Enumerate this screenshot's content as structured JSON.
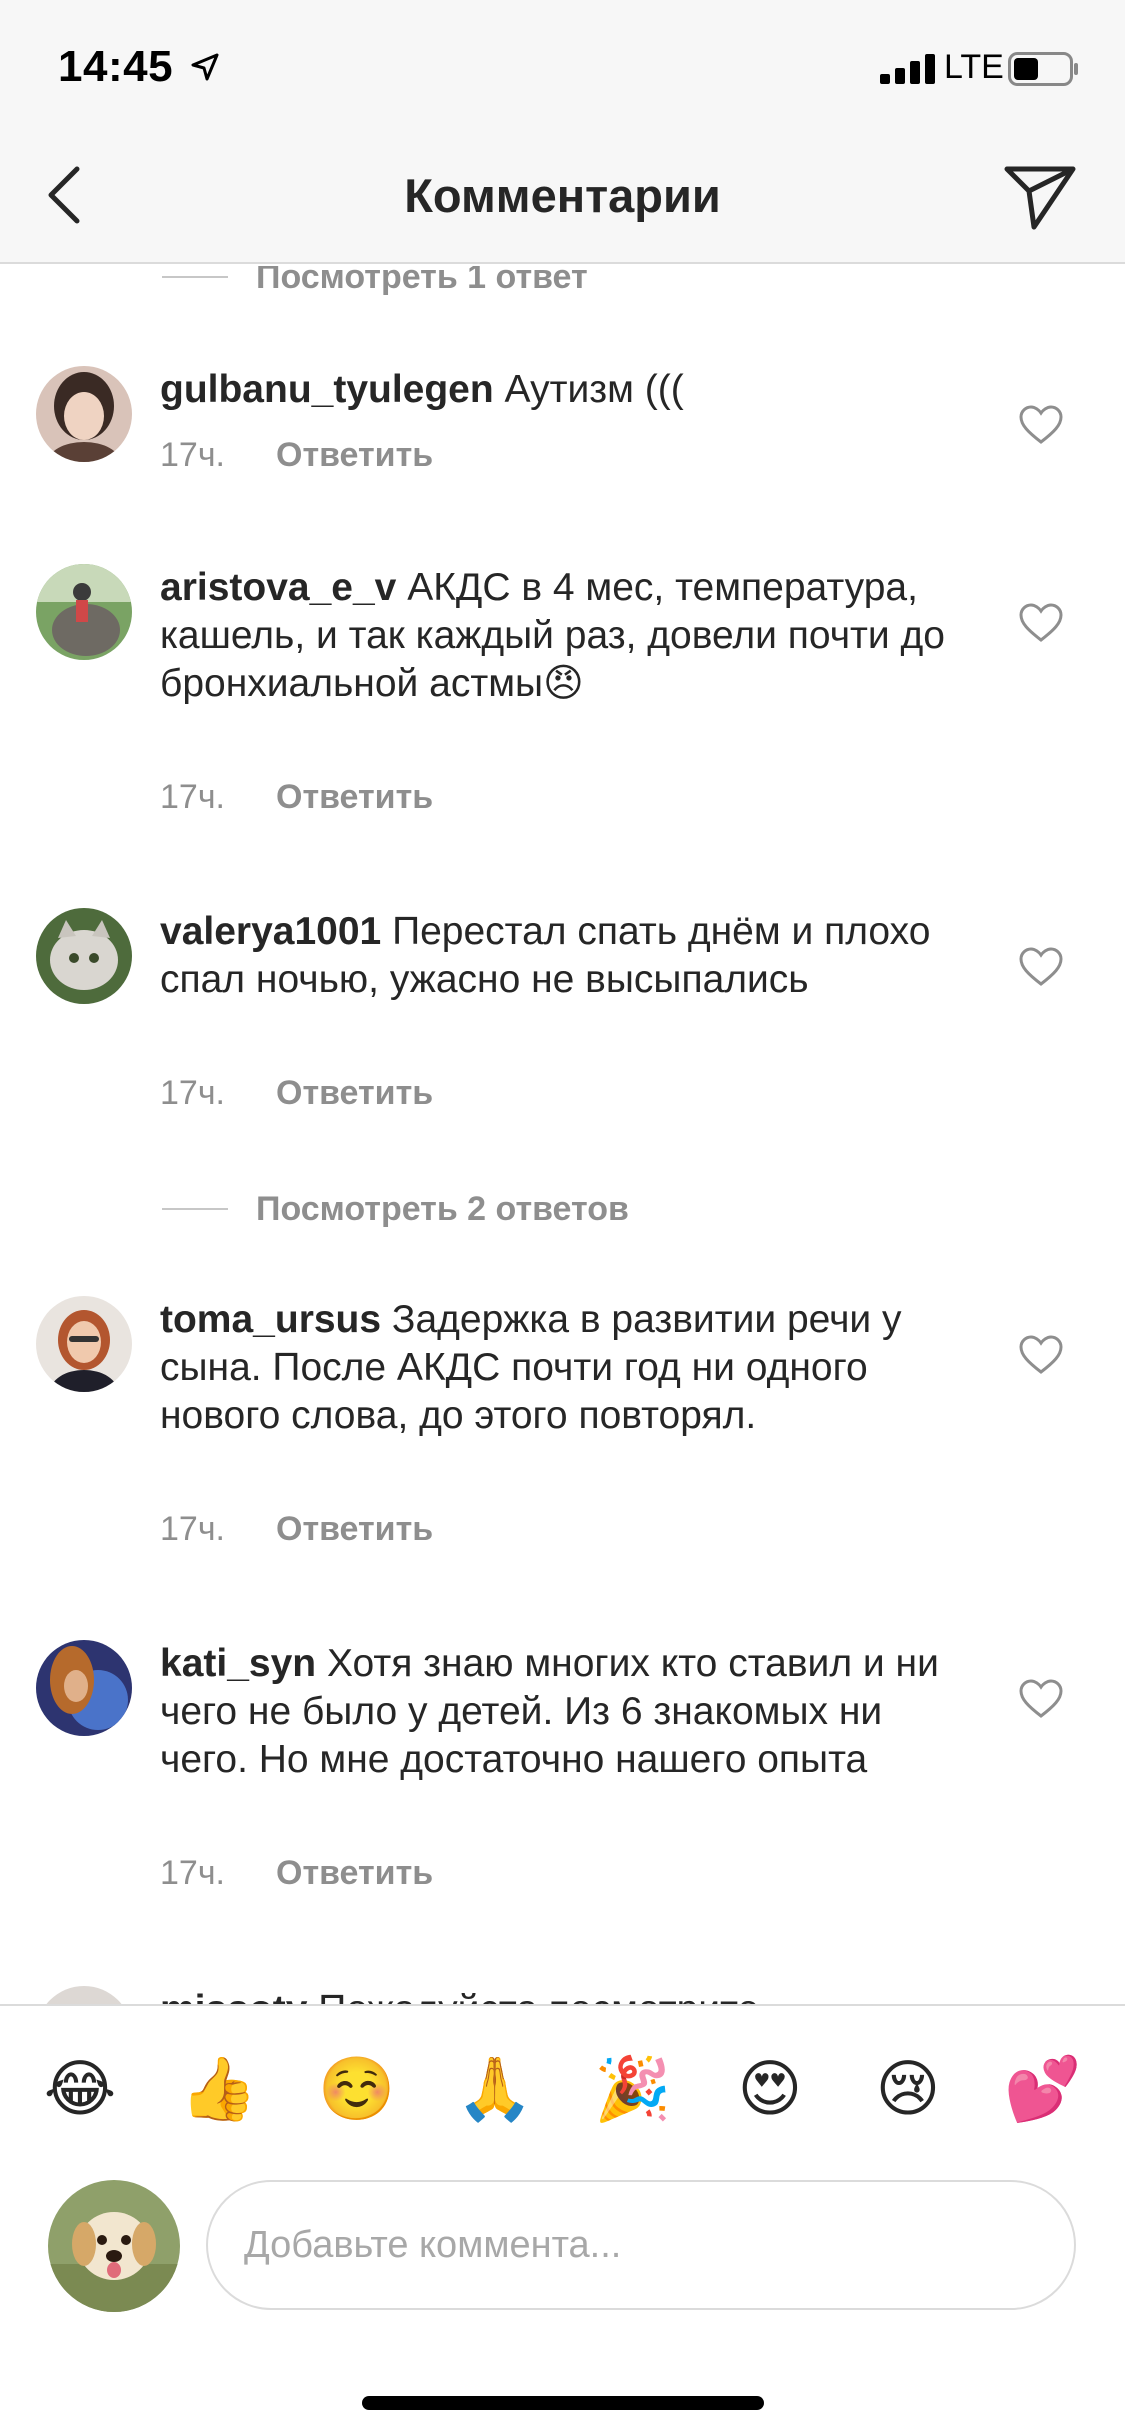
{
  "status_bar": {
    "time": "14:45",
    "network": "LTE"
  },
  "header": {
    "title": "Комментарии"
  },
  "view_replies": [
    "Посмотреть 1 ответ",
    "Посмотреть 2 ответов"
  ],
  "comments": [
    {
      "user": "gulbanu_tyulegen",
      "text": "Аутизм (((",
      "time": "17ч.",
      "reply": "Ответить"
    },
    {
      "user": "aristova_e_v",
      "text": "АКДС в 4 мес, температура, кашель, и так каждый раз, довели почти до бронхиальной астмы😠",
      "time": "17ч.",
      "reply": "Ответить"
    },
    {
      "user": "valerya1001",
      "text": "Перестал спать днём и плохо спал ночью, ужасно не высыпались",
      "time": "17ч.",
      "reply": "Ответить"
    },
    {
      "user": "toma_ursus",
      "text": "Задержка в развитии речи у сына. После АКДС почти год ни одного нового слова, до этого повторял.",
      "time": "17ч.",
      "reply": "Ответить"
    },
    {
      "user": "kati_syn",
      "text": "Хотя знаю многих кто ставил и ни чего не было у детей. Из 6 знакомых ни чего. Но мне достаточно нашего опыта",
      "time": "17ч.",
      "reply": "Ответить"
    },
    {
      "user": "missoty",
      "text": "Пожалуйста посмотрите"
    }
  ],
  "emoji_bar": [
    "😂",
    "👍",
    "☺️",
    "🙏",
    "🎉",
    "😍",
    "😢",
    "💕"
  ],
  "composer": {
    "placeholder": "Добавьте коммента..."
  },
  "icons": {
    "back": "chevron-left-icon",
    "send": "paper-plane-icon",
    "like": "heart-outline-icon"
  },
  "colors": {
    "text": "#262626",
    "secondary": "#8e8e8e",
    "divider": "#dbdbdb",
    "bar_bg": "#f7f7f7"
  }
}
